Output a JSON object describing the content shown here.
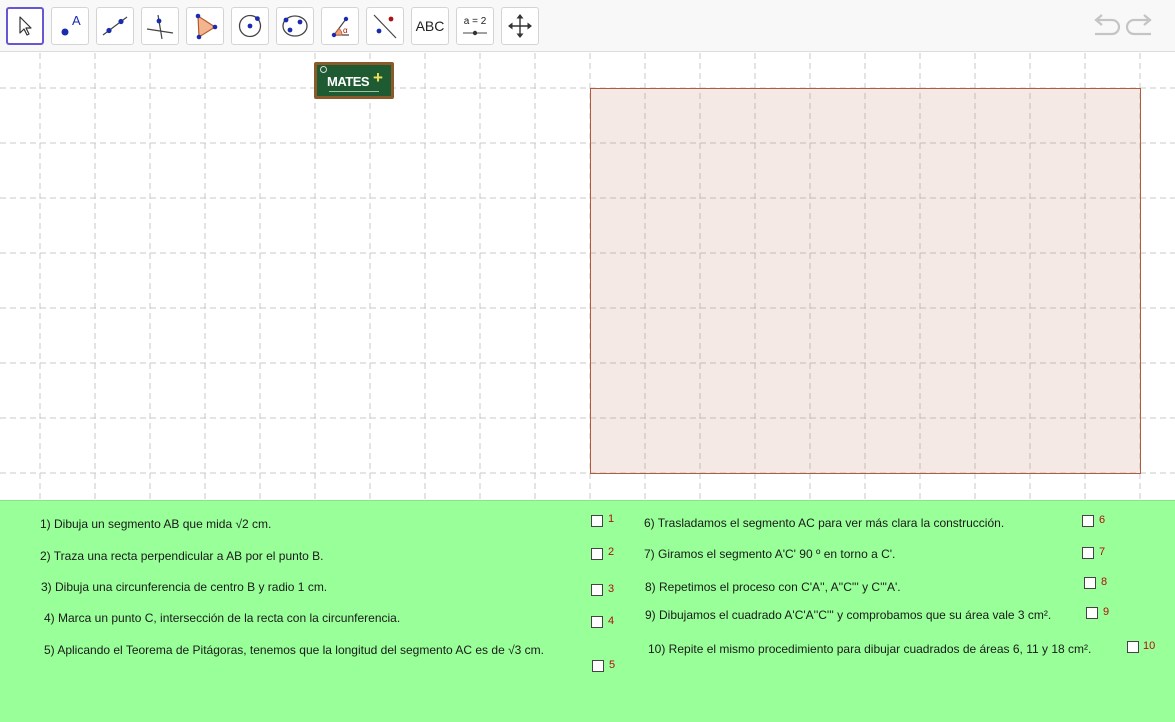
{
  "toolbar": {
    "tools": [
      {
        "name": "move-tool",
        "icon": "cursor-arrow-icon"
      },
      {
        "name": "point-tool",
        "icon": "point-icon",
        "label": "A"
      },
      {
        "name": "line-tool",
        "icon": "line-through-two-points-icon"
      },
      {
        "name": "perpendicular-line-tool",
        "icon": "perpendicular-line-icon"
      },
      {
        "name": "polygon-tool",
        "icon": "polygon-icon"
      },
      {
        "name": "circle-center-point-tool",
        "icon": "circle-center-point-icon"
      },
      {
        "name": "conic-tool",
        "icon": "circle-through-points-icon"
      },
      {
        "name": "angle-tool",
        "icon": "angle-icon",
        "label": "α"
      },
      {
        "name": "reflect-tool",
        "icon": "reflect-about-line-icon"
      },
      {
        "name": "text-tool",
        "label": "ABC"
      },
      {
        "name": "slider-tool",
        "label": "a = 2"
      },
      {
        "name": "move-graphics-view-tool",
        "icon": "move-arrows-icon"
      }
    ],
    "undo_icon": "undo-icon",
    "redo_icon": "redo-icon"
  },
  "logo": {
    "text": "MATES",
    "plus": "+"
  },
  "colors": {
    "selected_border": "#6557d2",
    "panel_bg": "#99ff99",
    "square_fill": "#f2e7e3",
    "square_border": "#b45a3f",
    "checkbox_number": "#b01010",
    "grid_line": "#c8c8c8"
  },
  "steps_left": [
    {
      "text": "1) Dibuja un segmento AB que mida √2 cm.",
      "num": "1"
    },
    {
      "text": "2) Traza una recta perpendicular a AB por el punto B.",
      "num": "2"
    },
    {
      "text": "3) Dibuja una circunferencia de centro B y radio 1 cm.",
      "num": "3"
    },
    {
      "text": "4) Marca un punto C, intersección de la recta con la circunferencia.",
      "num": "4"
    },
    {
      "text": "5) Aplicando el Teorema de Pitágoras, tenemos que la longitud del segmento AC es de √3 cm.",
      "num": "5"
    }
  ],
  "steps_right": [
    {
      "text": "6) Trasladamos el segmento AC para ver más clara la construcción.",
      "num": "6"
    },
    {
      "text": "7) Giramos el segmento A'C' 90 º en torno a C'.",
      "num": "7"
    },
    {
      "text": "8) Repetimos el proceso con C'A'', A''C''' y C'''A'.",
      "num": "8"
    },
    {
      "text": "9) Dibujamos el cuadrado A'C'A''C''' y comprobamos que su área vale 3 cm².",
      "num": "9"
    },
    {
      "text": "10) Repite el mismo procedimiento para dibujar cuadrados de áreas 6, 11 y 18 cm².",
      "num": "10"
    }
  ]
}
